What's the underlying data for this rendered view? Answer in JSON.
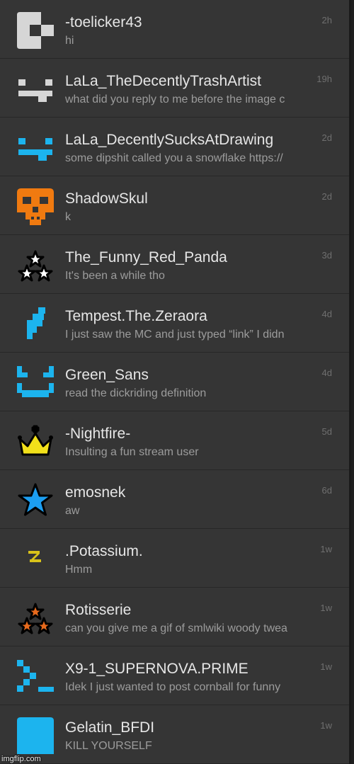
{
  "conversations": [
    {
      "name": "-toelicker43",
      "message": "hi",
      "time": "2h",
      "icon": "checker-block-icon",
      "color": "#d6d6d6"
    },
    {
      "name": "LaLa_TheDecentlyTrashArtist",
      "message": "what did you reply to me before the image c",
      "time": "19h",
      "icon": "pixel-face-icon",
      "color": "#d6d6d6"
    },
    {
      "name": "LaLa_DecentlySucksAtDrawing",
      "message": "some dipshit called you a snowflake https://",
      "time": "2d",
      "icon": "pixel-face-icon",
      "color": "#1cb4ee"
    },
    {
      "name": "ShadowSkul",
      "message": "k",
      "time": "2d",
      "icon": "pixel-skull-icon",
      "color": "#f07a10"
    },
    {
      "name": "The_Funny_Red_Panda",
      "message": "It's been a while tho",
      "time": "3d",
      "icon": "three-stars-icon",
      "color": "#ffffff"
    },
    {
      "name": "Tempest.The.Zeraora",
      "message": "I just saw the MC and just typed “link” I didn",
      "time": "4d",
      "icon": "pixel-bolt-icon",
      "color": "#1cb4ee"
    },
    {
      "name": "Green_Sans",
      "message": "read the dickriding definition",
      "time": "4d",
      "icon": "pixel-smile-icon",
      "color": "#1cb4ee"
    },
    {
      "name": "-Nightfire-",
      "message": "Insulting a fun stream user",
      "time": "5d",
      "icon": "crown-icon",
      "color": "#f2e01a"
    },
    {
      "name": "emosnek",
      "message": "aw",
      "time": "6d",
      "icon": "star-icon",
      "color": "#1c9ef0"
    },
    {
      "name": ".Potassium.",
      "message": "Hmm",
      "time": "1w",
      "icon": "lightning-icon",
      "color": "#d8c21a"
    },
    {
      "name": "Rotisserie",
      "message": "can you give me a gif of smlwiki woody twea",
      "time": "1w",
      "icon": "three-stars-icon",
      "color": "#e86a1c"
    },
    {
      "name": "X9-1_SUPERNOVA.PRIME",
      "message": "Idek I just wanted to post cornball for funny",
      "time": "1w",
      "icon": "terminal-prompt-icon",
      "color": "#1cb4ee"
    },
    {
      "name": "Gelatin_BFDI",
      "message": "KILL YOURSELF",
      "time": "1w",
      "icon": "blue-square-icon",
      "color": "#1cb4ee"
    }
  ],
  "watermark": "imgflip.com"
}
